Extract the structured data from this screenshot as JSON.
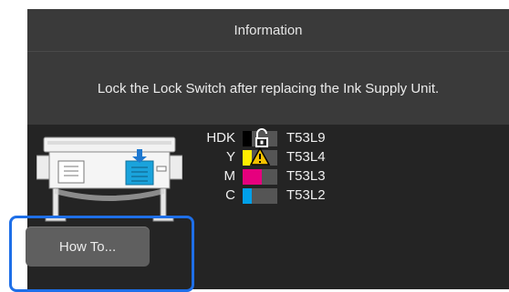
{
  "header": {
    "title": "Information"
  },
  "message": {
    "text": "Lock the Lock Switch after replacing the Ink Supply Unit."
  },
  "inks": [
    {
      "name": "HDK",
      "code": "T53L9",
      "color": "#000000",
      "level": 0.25,
      "status_icon": "unlock-icon"
    },
    {
      "name": "Y",
      "code": "T53L4",
      "color": "#ffee00",
      "level": 0.25,
      "status_icon": "warning-icon"
    },
    {
      "name": "M",
      "code": "T53L3",
      "color": "#e6007e",
      "level": 0.55,
      "status_icon": ""
    },
    {
      "name": "C",
      "code": "T53L2",
      "color": "#00a0e9",
      "level": 0.25,
      "status_icon": ""
    }
  ],
  "actions": {
    "how_to_label": "How To..."
  },
  "colors": {
    "highlight": "#1e6fe8",
    "background": "#242424",
    "panel": "#3a3a3a"
  }
}
